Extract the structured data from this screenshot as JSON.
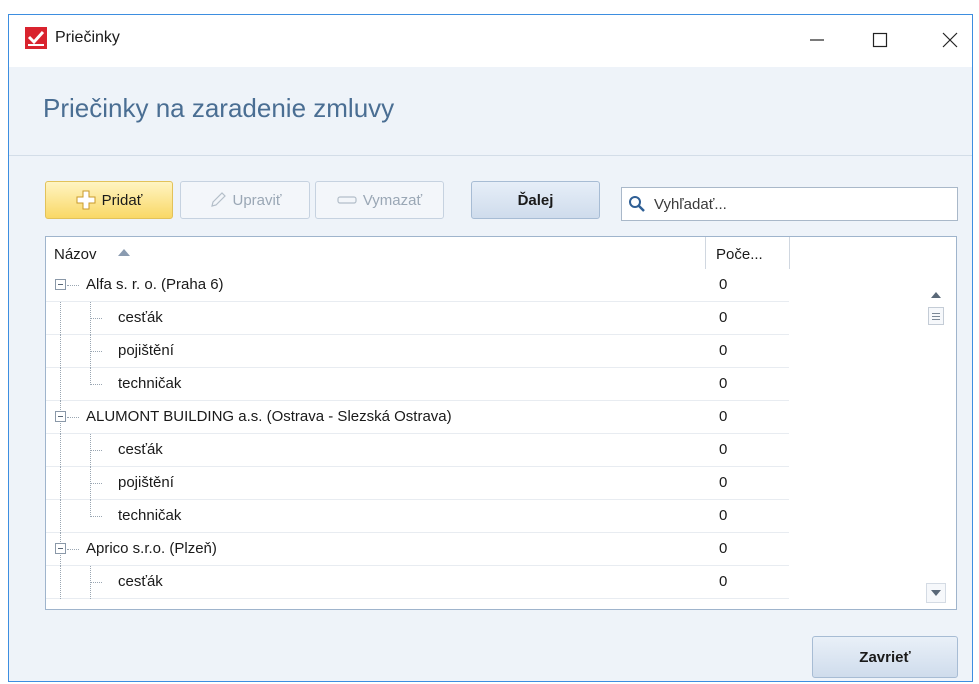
{
  "window": {
    "title": "Priečinky",
    "accent": "#d9232e",
    "border_color": "#3d8ee0"
  },
  "header": {
    "title": "Priečinky na zaradenie zmluvy"
  },
  "toolbar": {
    "add_label": "Pridať",
    "edit_label": "Upraviť",
    "delete_label": "Vymazať",
    "next_label": "Ďalej"
  },
  "search": {
    "placeholder": "Vyhľadať..."
  },
  "grid": {
    "columns": {
      "name": "Názov",
      "count": "Poče..."
    },
    "rows": [
      {
        "label": "Alfa s. r. o. (Praha 6)",
        "count": "0",
        "level": 0
      },
      {
        "label": "cesťák",
        "count": "0",
        "level": 1
      },
      {
        "label": "pojištění",
        "count": "0",
        "level": 1
      },
      {
        "label": "techničak",
        "count": "0",
        "level": 1
      },
      {
        "label": "ALUMONT BUILDING a.s. (Ostrava - Slezská Ostrava)",
        "count": "0",
        "level": 0
      },
      {
        "label": "cesťák",
        "count": "0",
        "level": 1
      },
      {
        "label": "pojištění",
        "count": "0",
        "level": 1
      },
      {
        "label": "techničak",
        "count": "0",
        "level": 1
      },
      {
        "label": "Aprico s.r.o. (Plzeň)",
        "count": "0",
        "level": 0
      },
      {
        "label": "cesťák",
        "count": "0",
        "level": 1
      }
    ]
  },
  "footer": {
    "close_label": "Zavrieť"
  }
}
